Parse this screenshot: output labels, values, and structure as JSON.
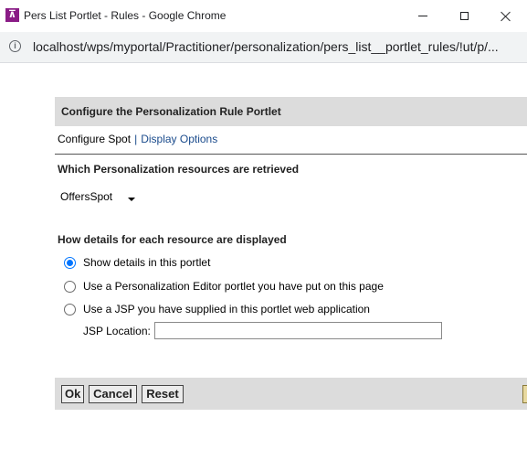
{
  "window": {
    "title": "Pers List Portlet - Rules - Google Chrome",
    "app_icon": "portal-logo-icon",
    "controls": [
      "minimize-icon",
      "maximize-icon",
      "close-icon"
    ]
  },
  "address": {
    "url": "localhost/wps/myportal/Practitioner/personalization/pers_list__portlet_rules/!ut/p/...",
    "icon": "info-icon"
  },
  "portlet": {
    "header": "Configure the Personalization Rule Portlet",
    "config_spot": "Configure Spot",
    "separator": "|",
    "display_options": "Display Options",
    "resources_label": "Which Personalization resources are retrieved",
    "resource_selected": "OffersSpot",
    "details_label": "How details for each resource are displayed",
    "radio_options": [
      {
        "label": "Show details in this portlet",
        "checked": true
      },
      {
        "label": "Use a Personalization Editor portlet you have put on this page",
        "checked": false
      },
      {
        "label": "Use a JSP you have supplied in this portlet web application",
        "checked": false
      }
    ],
    "jsp_location_label": "JSP Location:",
    "jsp_location_value": ""
  },
  "buttons": {
    "ok": "Ok",
    "cancel": "Cancel",
    "reset": "Reset"
  },
  "colors": {
    "header_bg": "#dcdcdc",
    "link": "#1a4b8c",
    "radio_accent": "#0075ff",
    "app_icon_bg": "#8a1c86"
  }
}
